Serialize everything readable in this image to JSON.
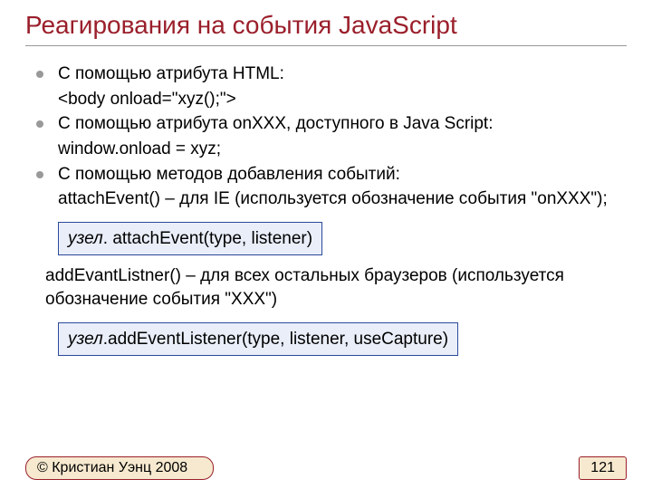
{
  "title": "Реагирования на события JavaScript",
  "bullets": [
    {
      "main": "С помощью атрибута HTML:",
      "sub": "<body onload=\"xyz();\">"
    },
    {
      "main": "С помощью атрибута onXXX, доступного в Java Script:",
      "sub": "window.onload = xyz;"
    },
    {
      "main": "С помощью методов добавления событий:",
      "sub": "attachEvent() – для IE (используется обозначение события \"onXXX\");"
    }
  ],
  "codebox1": {
    "prefix": "узел",
    "rest": ". attachEvent(type, listener)"
  },
  "paragraph": "addEvantListner() – для всех остальных браузеров (используется обозначение события \"XXX\")",
  "codebox2": {
    "prefix": "узел",
    "rest": ".addEventListener(type, listener, useCapture)"
  },
  "footer": {
    "copyright": "© Кристиан Уэнц 2008",
    "page": "121"
  }
}
